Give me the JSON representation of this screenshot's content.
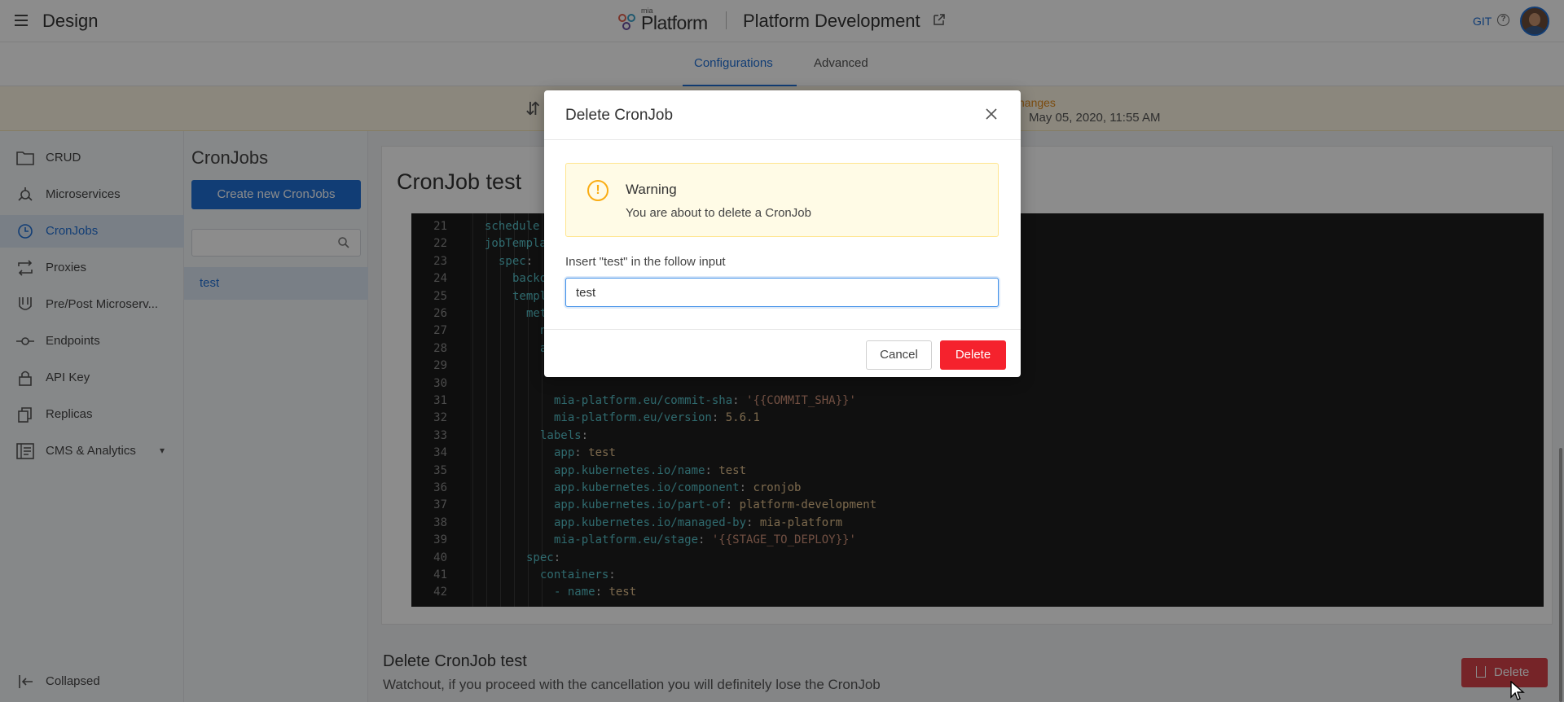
{
  "header": {
    "app_title": "Design",
    "logo_small": "mia",
    "logo_text": "Platform",
    "project_name": "Platform Development",
    "git_label": "GIT",
    "help_symbol": "?"
  },
  "tabs": [
    {
      "label": "Configurations",
      "active": true
    },
    {
      "label": "Advanced",
      "active": false
    }
  ],
  "banner": {
    "changes_text": "nanges",
    "date": "May 05, 2020, 11:55 AM"
  },
  "sidebar": {
    "items": [
      {
        "label": "CRUD",
        "icon": "folder-icon"
      },
      {
        "label": "Microservices",
        "icon": "microservices-icon"
      },
      {
        "label": "CronJobs",
        "icon": "clock-icon",
        "active": true
      },
      {
        "label": "Proxies",
        "icon": "proxies-icon"
      },
      {
        "label": "Pre/Post Microserv...",
        "icon": "decorators-icon"
      },
      {
        "label": "Endpoints",
        "icon": "endpoints-icon"
      },
      {
        "label": "API Key",
        "icon": "lock-icon"
      },
      {
        "label": "Replicas",
        "icon": "replicas-icon"
      },
      {
        "label": "CMS & Analytics",
        "icon": "cms-icon"
      }
    ],
    "collapse_label": "Collapsed"
  },
  "sublist": {
    "title": "CronJobs",
    "create_label": "Create new CronJobs",
    "search_value": "",
    "items": [
      "test"
    ]
  },
  "main": {
    "title": "CronJob test",
    "code_lines": [
      {
        "n": "21",
        "indent": 0,
        "key": "schedule",
        "rest": ""
      },
      {
        "n": "22",
        "indent": 0,
        "key": "jobTemplat",
        "rest": ""
      },
      {
        "n": "23",
        "indent": 1,
        "key": "spec",
        "rest": ":"
      },
      {
        "n": "24",
        "indent": 2,
        "key": "backof",
        "rest": ""
      },
      {
        "n": "25",
        "indent": 2,
        "key": "templa",
        "rest": ""
      },
      {
        "n": "26",
        "indent": 3,
        "key": "meta",
        "rest": ""
      },
      {
        "n": "27",
        "indent": 4,
        "key": "na",
        "rest": ""
      },
      {
        "n": "28",
        "indent": 4,
        "key": "an",
        "rest": ""
      },
      {
        "n": "29",
        "indent": 5,
        "key": "",
        "rest": ""
      },
      {
        "n": "30",
        "indent": 5,
        "key": "",
        "rest": ""
      },
      {
        "n": "31",
        "indent": 5,
        "key": "mia-platform.eu/commit-sha",
        "rest": ": ",
        "val": "'{{COMMIT_SHA}}'",
        "str": true
      },
      {
        "n": "32",
        "indent": 5,
        "key": "mia-platform.eu/version",
        "rest": ": ",
        "val": "5.6.1"
      },
      {
        "n": "33",
        "indent": 4,
        "key": "labels",
        "rest": ":"
      },
      {
        "n": "34",
        "indent": 5,
        "key": "app",
        "rest": ": ",
        "val": "test"
      },
      {
        "n": "35",
        "indent": 5,
        "key": "app.kubernetes.io/name",
        "rest": ": ",
        "val": "test"
      },
      {
        "n": "36",
        "indent": 5,
        "key": "app.kubernetes.io/component",
        "rest": ": ",
        "val": "cronjob"
      },
      {
        "n": "37",
        "indent": 5,
        "key": "app.kubernetes.io/part-of",
        "rest": ": ",
        "val": "platform-development"
      },
      {
        "n": "38",
        "indent": 5,
        "key": "app.kubernetes.io/managed-by",
        "rest": ": ",
        "val": "mia-platform"
      },
      {
        "n": "39",
        "indent": 5,
        "key": "mia-platform.eu/stage",
        "rest": ": ",
        "val": "'{{STAGE_TO_DEPLOY}}'",
        "str": true
      },
      {
        "n": "40",
        "indent": 3,
        "key": "spec",
        "rest": ":"
      },
      {
        "n": "41",
        "indent": 4,
        "key": "containers",
        "rest": ":"
      },
      {
        "n": "42",
        "indent": 5,
        "key": "- name",
        "rest": ": ",
        "val": "test"
      }
    ],
    "delete_section": {
      "title": "Delete CronJob test",
      "description": "Watchout, if you proceed with the cancellation you will definitely lose the CronJob",
      "button_label": "Delete"
    }
  },
  "modal": {
    "title": "Delete CronJob",
    "warning_title": "Warning",
    "warning_text": "You are about to delete a CronJob",
    "input_label": "Insert \"test\" in the follow input",
    "input_value": "test",
    "cancel_label": "Cancel",
    "delete_label": "Delete",
    "warning_symbol": "!"
  }
}
